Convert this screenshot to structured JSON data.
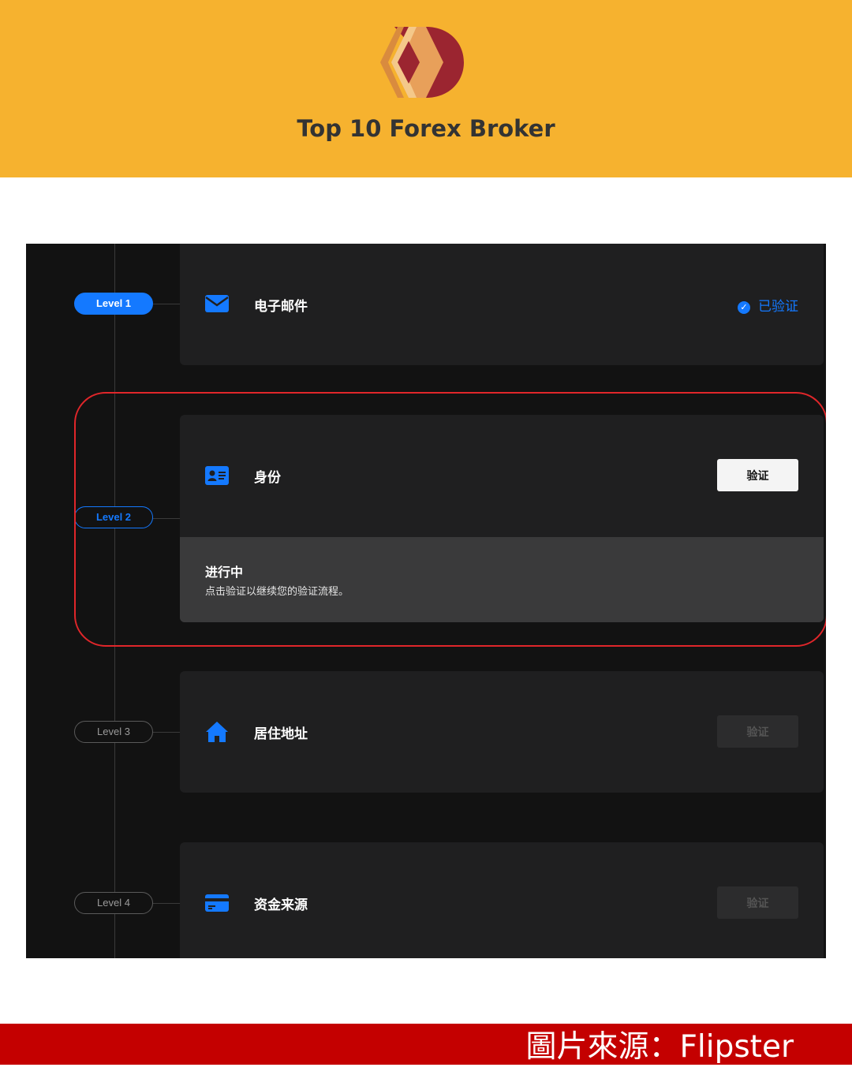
{
  "banner": {
    "brand_text": "Top 10 Forex Broker",
    "logo_name": "top10-forex-broker-logo",
    "background": "#f6b22f"
  },
  "verification": {
    "accent": "#1479ff",
    "levels": [
      {
        "level_label": "Level 1",
        "state": "completed",
        "icon": "envelope-icon",
        "title": "电子邮件",
        "status": "已验证"
      },
      {
        "level_label": "Level 2",
        "state": "current",
        "icon": "id-card-icon",
        "title": "身份",
        "button": "验证",
        "progress": {
          "title": "进行中",
          "description": "点击验证以继续您的验证流程。"
        }
      },
      {
        "level_label": "Level 3",
        "state": "locked",
        "icon": "home-icon",
        "title": "居住地址",
        "button": "验证"
      },
      {
        "level_label": "Level 4",
        "state": "locked",
        "icon": "credit-card-icon",
        "title": "资金来源",
        "button": "验证"
      }
    ],
    "highlight_color": "#e0262a"
  },
  "footer": {
    "source_text": "圖片來源：Flipster",
    "background": "#c40000"
  }
}
